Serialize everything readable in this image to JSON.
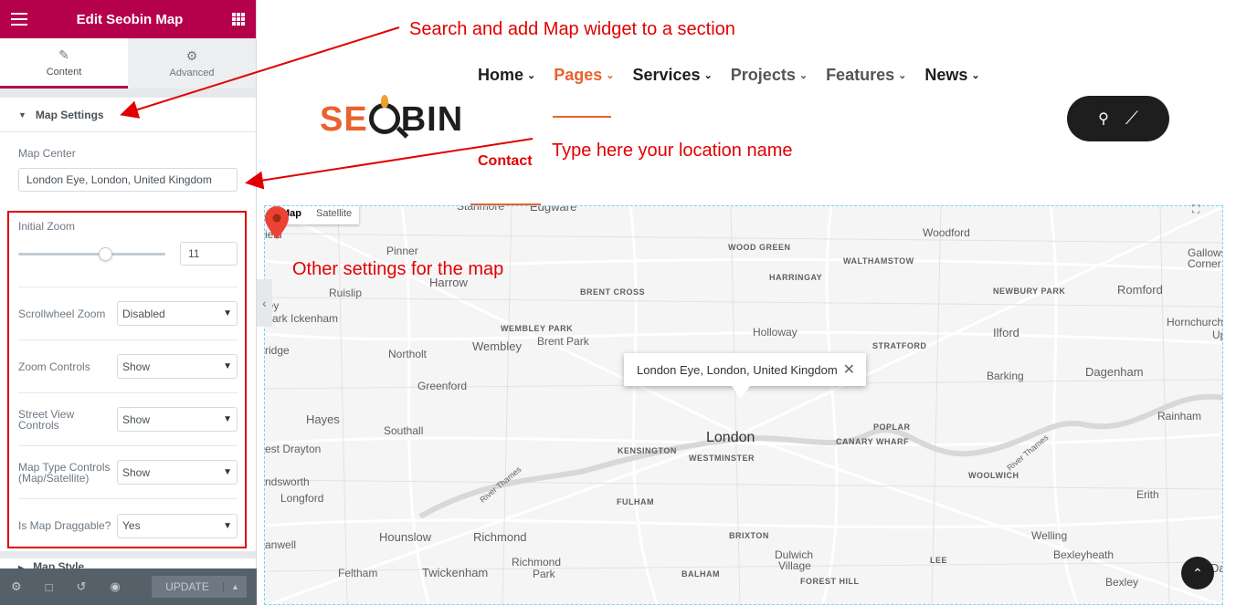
{
  "panel": {
    "title": "Edit Seobin Map",
    "tabs": [
      {
        "label": "Content",
        "icon": "pencil-icon"
      },
      {
        "label": "Advanced",
        "icon": "gear-icon"
      }
    ],
    "section_title": "Map Settings",
    "map_center": {
      "label": "Map Center",
      "value": "London Eye, London, United Kingdom"
    },
    "initial_zoom": {
      "label": "Initial Zoom",
      "value": "11",
      "slider_fraction": 0.59
    },
    "settings": [
      {
        "label": "Scrollwheel Zoom",
        "value": "Disabled"
      },
      {
        "label": "Zoom Controls",
        "value": "Show"
      },
      {
        "label": "Street View Controls",
        "value": "Show"
      },
      {
        "label": "Map Type Controls (Map/Satellite)",
        "value": "Show"
      },
      {
        "label": "Is Map Draggable?",
        "value": "Yes"
      }
    ],
    "next_section": "Map Style",
    "footer": {
      "update_label": "UPDATE"
    }
  },
  "site": {
    "logo": {
      "part1": "SE",
      "part2": "BIN"
    },
    "nav": [
      {
        "label": "Home",
        "style": "dark"
      },
      {
        "label": "Pages",
        "style": "active"
      },
      {
        "label": "Services",
        "style": "dark"
      },
      {
        "label": "Projects",
        "style": "gray"
      },
      {
        "label": "Features",
        "style": "gray"
      },
      {
        "label": "News",
        "style": "dark"
      }
    ],
    "contact": "Contact"
  },
  "map": {
    "type_buttons": [
      "Map",
      "Satellite"
    ],
    "info_window": "London Eye, London, United Kingdom",
    "labels": [
      {
        "t": "Stanmore",
        "c": "md"
      },
      {
        "t": "Edgware",
        "c": "lg"
      },
      {
        "t": "Woodford",
        "c": "md"
      },
      {
        "t": "ield",
        "c": "md"
      },
      {
        "t": "Pinner",
        "c": "md"
      },
      {
        "t": "WOOD GREEN",
        "c": "sm"
      },
      {
        "t": "WALTHAMSTOW",
        "c": "sm"
      },
      {
        "t": "Gallows",
        "c": "md"
      },
      {
        "t": "Corner",
        "c": "md"
      },
      {
        "t": "Harrow",
        "c": "lg"
      },
      {
        "t": "HARRINGAY",
        "c": "sm"
      },
      {
        "t": "Ruislip",
        "c": "md"
      },
      {
        "t": "BRENT CROSS",
        "c": "sm"
      },
      {
        "t": "NEWBURY PARK",
        "c": "sm"
      },
      {
        "t": "Romford",
        "c": "lg"
      },
      {
        "t": "ley",
        "c": "md"
      },
      {
        "t": "Park Ickenham",
        "c": "md"
      },
      {
        "t": "Hornchurch",
        "c": "md"
      },
      {
        "t": "WEMBLEY PARK",
        "c": "sm"
      },
      {
        "t": "Holloway",
        "c": "md"
      },
      {
        "t": "Up",
        "c": "md"
      },
      {
        "t": "Brent Park",
        "c": "md"
      },
      {
        "t": "Wembley",
        "c": "lg"
      },
      {
        "t": "Ilford",
        "c": "lg"
      },
      {
        "t": "ridge",
        "c": "md"
      },
      {
        "t": "Northolt",
        "c": "md"
      },
      {
        "t": "STRATFORD",
        "c": "sm"
      },
      {
        "t": "Barking",
        "c": "md"
      },
      {
        "t": "Dagenham",
        "c": "lg"
      },
      {
        "t": "Greenford",
        "c": "md"
      },
      {
        "t": "Hayes",
        "c": "lg"
      },
      {
        "t": "POPLAR",
        "c": "sm"
      },
      {
        "t": "Rainham",
        "c": "md"
      },
      {
        "t": "Southall",
        "c": "md"
      },
      {
        "t": "London",
        "c": "xl"
      },
      {
        "t": "CANARY WHARF",
        "c": "sm"
      },
      {
        "t": "est Drayton",
        "c": "md"
      },
      {
        "t": "KENSINGTON",
        "c": "sm"
      },
      {
        "t": "WESTMINSTER",
        "c": "sm"
      },
      {
        "t": "River Thames",
        "c": "md"
      },
      {
        "t": "WOOLWICH",
        "c": "sm"
      },
      {
        "t": "ndsworth",
        "c": "md"
      },
      {
        "t": "Longford",
        "c": "md"
      },
      {
        "t": "River Thames",
        "c": "md"
      },
      {
        "t": "FULHAM",
        "c": "sm"
      },
      {
        "t": "Erith",
        "c": "md"
      },
      {
        "t": "Hounslow",
        "c": "lg"
      },
      {
        "t": "Richmond",
        "c": "lg"
      },
      {
        "t": "BRIXTON",
        "c": "sm"
      },
      {
        "t": "Welling",
        "c": "md"
      },
      {
        "t": "anwell",
        "c": "md"
      },
      {
        "t": "Dulwich",
        "c": "md"
      },
      {
        "t": "Village",
        "c": "md"
      },
      {
        "t": "Bexleyheath",
        "c": "md"
      },
      {
        "t": "Richmond",
        "c": "md"
      },
      {
        "t": "Park",
        "c": "md"
      },
      {
        "t": "LEE",
        "c": "sm"
      },
      {
        "t": "Feltham",
        "c": "md"
      },
      {
        "t": "Twickenham",
        "c": "lg"
      },
      {
        "t": "BALHAM",
        "c": "sm"
      },
      {
        "t": "FOREST HILL",
        "c": "sm"
      },
      {
        "t": "Bexley",
        "c": "md"
      },
      {
        "t": "Da",
        "c": "lg"
      }
    ]
  },
  "annotations": {
    "a1": "Search and add Map widget to a section",
    "a2": "Type here your location name",
    "a3": "Other settings for the map"
  },
  "colors": {
    "brand": "#b5004b",
    "accent": "#e9622e",
    "annotation": "#e10000"
  }
}
